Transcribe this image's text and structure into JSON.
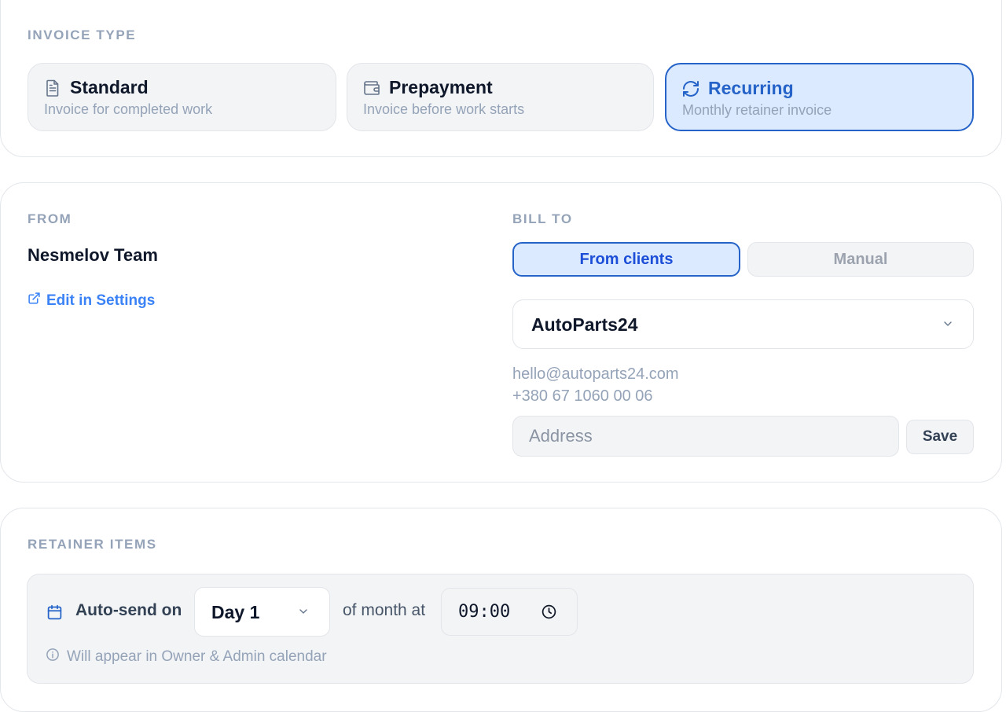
{
  "invoice_type": {
    "label": "INVOICE TYPE",
    "options": [
      {
        "title": "Standard",
        "subtitle": "Invoice for completed work",
        "icon": "document-icon"
      },
      {
        "title": "Prepayment",
        "subtitle": "Invoice before work starts",
        "icon": "wallet-icon"
      },
      {
        "title": "Recurring",
        "subtitle": "Monthly retainer invoice",
        "icon": "refresh-icon",
        "selected": true
      }
    ]
  },
  "from": {
    "label": "FROM",
    "name": "Nesmelov Team",
    "edit_link": "Edit in Settings"
  },
  "bill_to": {
    "label": "BILL TO",
    "mode_options": [
      "From clients",
      "Manual"
    ],
    "selected_mode": "From clients",
    "client": "AutoParts24",
    "email": "hello@autoparts24.com",
    "phone": "+380 67 1060 00 06",
    "address_placeholder": "Address",
    "save_label": "Save"
  },
  "retainer": {
    "label": "RETAINER ITEMS",
    "auto_send_label": "Auto-send on",
    "day": "Day 1",
    "of_month_label": "of month at",
    "time": "09:00",
    "hint": "Will appear in Owner & Admin calendar"
  },
  "colors": {
    "accent": "#2563c9",
    "accent_bg": "#dbeafe",
    "muted": "#94a3b8",
    "link": "#3b82f6"
  }
}
